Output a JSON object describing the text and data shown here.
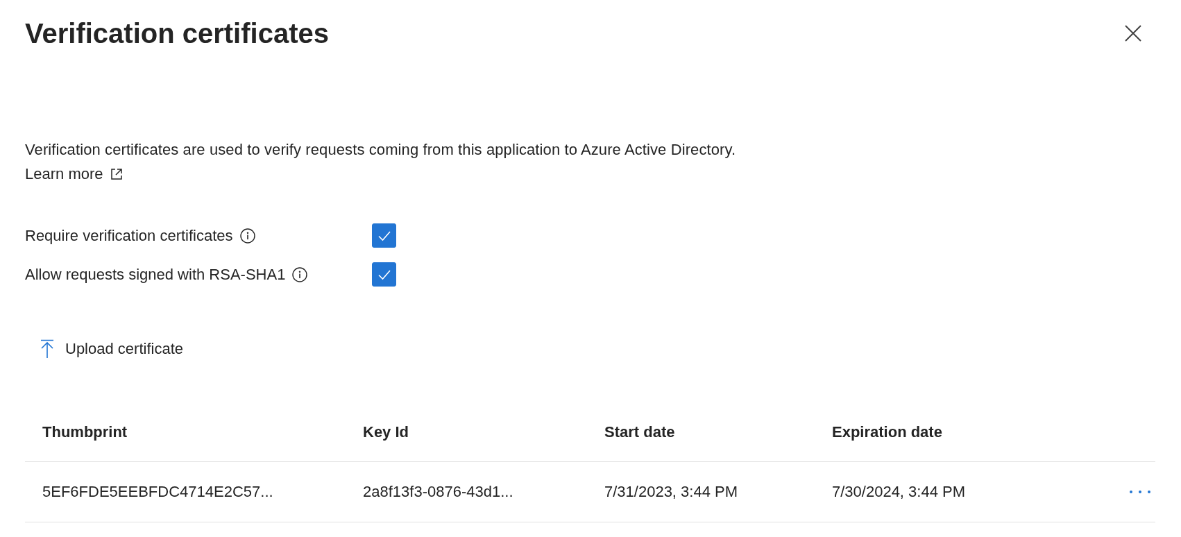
{
  "panel": {
    "title": "Verification certificates"
  },
  "description": "Verification certificates are used to verify requests coming from this application to Azure Active Directory.",
  "learn_more": "Learn more",
  "options": [
    {
      "label": "Require verification certificates",
      "checked": true
    },
    {
      "label": "Allow requests signed with RSA-SHA1",
      "checked": true
    }
  ],
  "upload_button": "Upload certificate",
  "table": {
    "columns": [
      "Thumbprint",
      "Key Id",
      "Start date",
      "Expiration date"
    ],
    "rows": [
      {
        "cells": [
          "5EF6FDE5EEBFDC4714E2C57...",
          "2a8f13f3-0876-43d1...",
          "7/31/2023, 3:44 PM",
          "7/30/2024, 3:44 PM"
        ]
      }
    ]
  }
}
